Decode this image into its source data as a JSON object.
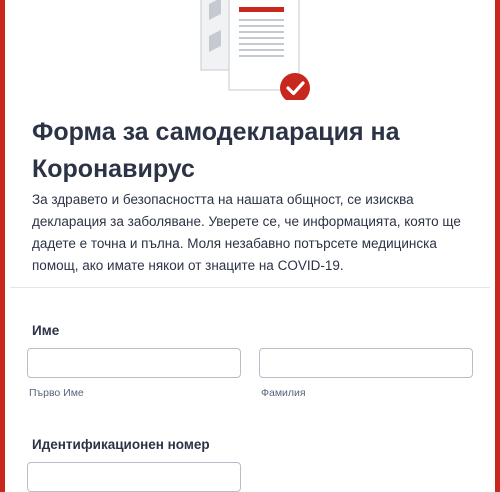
{
  "form": {
    "title": "Форма за самодекларация на Коронавирус",
    "description": "За здравето и безопасността на нашата общност, се изисква декларация за заболяване. Уверете се, че информацията, която ще дадете е точна и пълна. Моля незабавно потърсете медицинска помощ, ако имате някои от знаците на COVID-19.",
    "header_icon": "document-checkmark-icon",
    "accent_color": "#c8271e"
  },
  "name_field": {
    "label": "Име",
    "first_value": "",
    "first_sublabel": "Първо Име",
    "last_value": "",
    "last_sublabel": "Фамилия"
  },
  "id_field": {
    "label": "Идентификационен номер",
    "value": ""
  }
}
